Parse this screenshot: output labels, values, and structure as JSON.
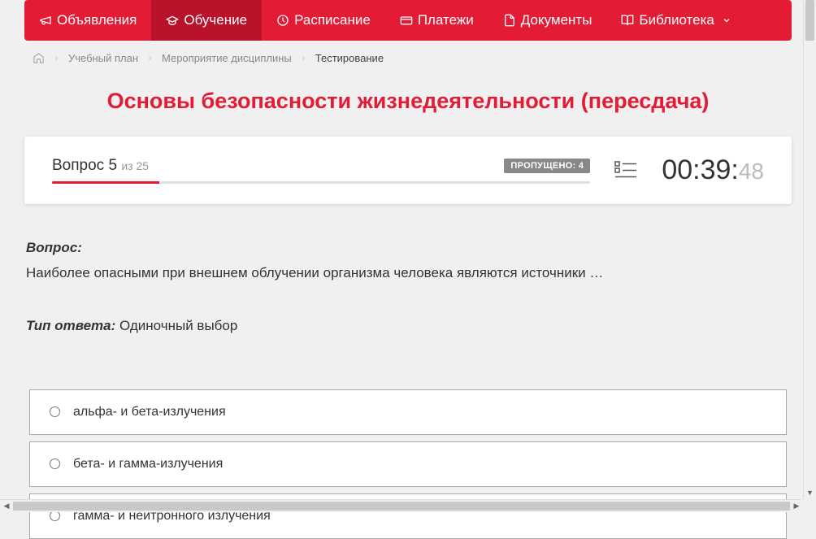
{
  "nav": {
    "items": [
      {
        "label": "Объявления",
        "icon": "megaphone"
      },
      {
        "label": "Обучение",
        "icon": "graduation",
        "active": true
      },
      {
        "label": "Расписание",
        "icon": "clock"
      },
      {
        "label": "Платежи",
        "icon": "card"
      },
      {
        "label": "Документы",
        "icon": "document"
      },
      {
        "label": "Библиотека",
        "icon": "book",
        "dropdown": true
      }
    ]
  },
  "breadcrumb": {
    "items": [
      {
        "label": "Учебный план"
      },
      {
        "label": "Мероприятие дисциплины"
      }
    ],
    "current": "Тестирование"
  },
  "title": "Основы безопасности жизнедеятельности (пересдача)",
  "progress": {
    "question_word": "Вопрос",
    "current": "5",
    "of_word": "из",
    "total": "25",
    "skipped_label": "ПРОПУЩЕНО: 4",
    "percent": 20
  },
  "timer": {
    "main": "00:39:",
    "ms": "48"
  },
  "question": {
    "header": "Вопрос:",
    "text": "Наиболее опасными при внешнем облучении организма человека являются источники …"
  },
  "answer_type": {
    "label": "Тип ответа:",
    "value": "Одиночный выбор"
  },
  "options": [
    {
      "label": "альфа- и бета-излучения"
    },
    {
      "label": "бета- и гамма-излучения"
    },
    {
      "label": "гамма- и нейтронного излучения"
    }
  ]
}
